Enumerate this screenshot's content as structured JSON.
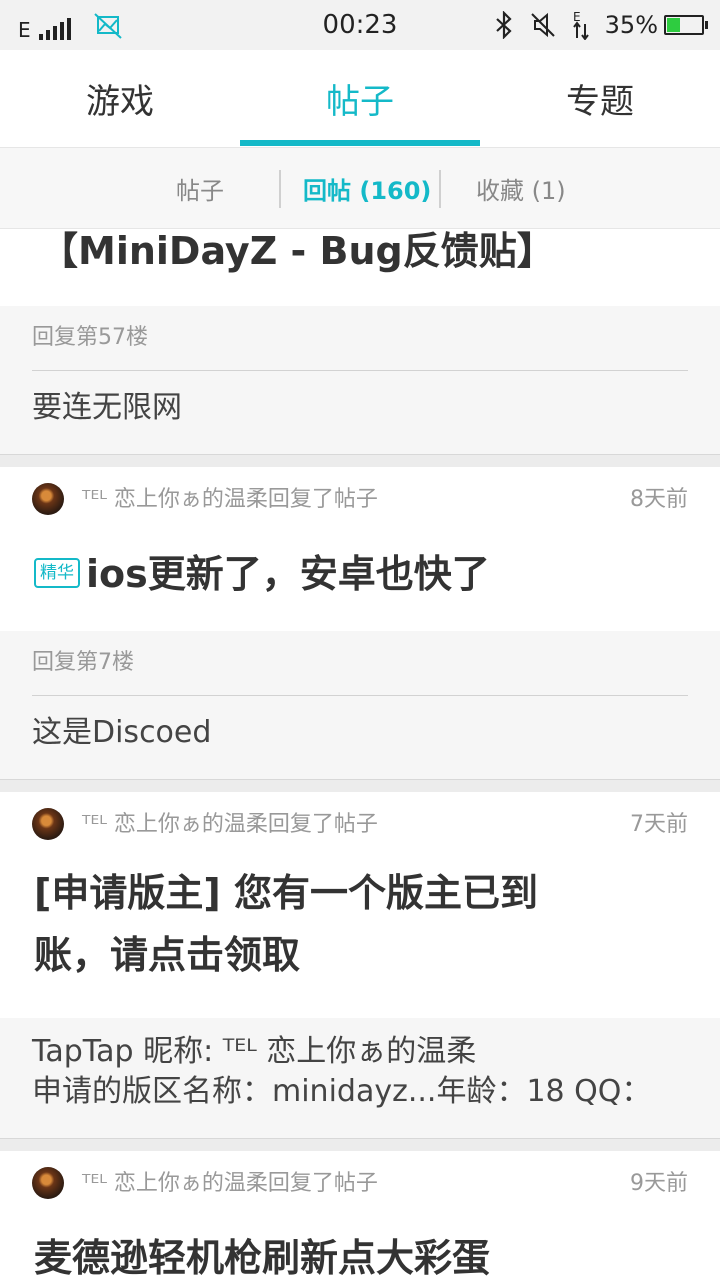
{
  "status_bar": {
    "network": "E",
    "time": "00:23",
    "battery": "35%",
    "battery_level": 0.35
  },
  "tabs": [
    {
      "label": "游戏",
      "active": false
    },
    {
      "label": "帖子",
      "active": true
    },
    {
      "label": "专题",
      "active": false
    }
  ],
  "subtabs": [
    {
      "label": "帖子",
      "active": false
    },
    {
      "label": "回帖 (160)",
      "active": true
    },
    {
      "label": "收藏 (1)",
      "active": false
    }
  ],
  "feed": [
    {
      "title": "【MiniDayZ - Bug反馈贴】",
      "reply_floor": "回复第57楼",
      "reply_text": "要连无限网"
    },
    {
      "user_action": "ᵀᴱᴸ 恋上你ぁ的温柔回复了帖子",
      "time": "8天前",
      "badge": "精华",
      "title": "ios更新了，安卓也快了",
      "reply_floor": "回复第7楼",
      "reply_text": "这是Discoed"
    },
    {
      "user_action": "ᵀᴱᴸ 恋上你ぁ的温柔回复了帖子",
      "time": "7天前",
      "title_line1": "[申请版主] 您有一个版主已到",
      "title_line2": "账，请点击领取",
      "reply_line1": "TapTap 昵称: ᵀᴱᴸ 恋上你ぁ的温柔",
      "reply_line2": "申请的版区名称：minidayz...年龄：18 QQ："
    },
    {
      "user_action": "ᵀᴱᴸ 恋上你ぁ的温柔回复了帖子",
      "time": "9天前",
      "title": "麦德逊轻机枪刷新点大彩蛋"
    }
  ]
}
